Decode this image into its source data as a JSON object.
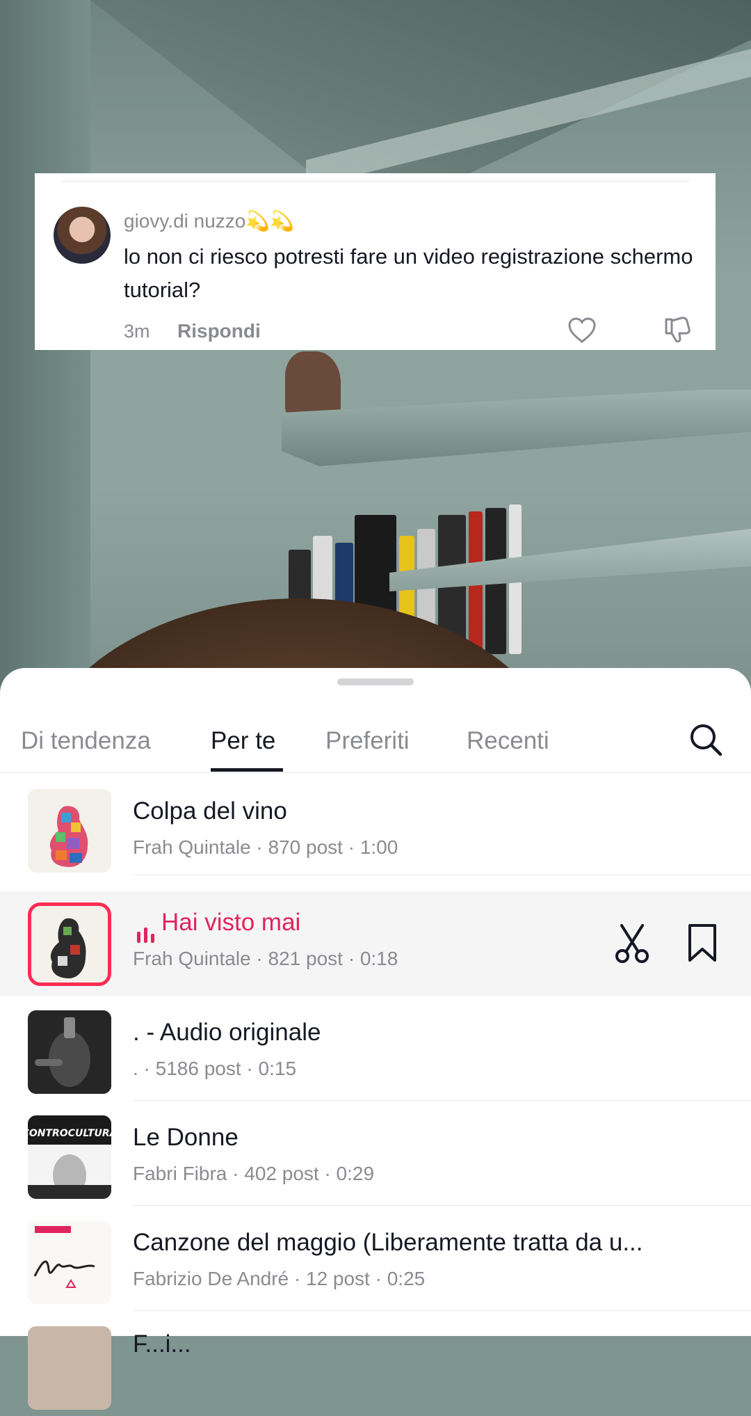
{
  "comment": {
    "username": "giovy.di nuzzo💫💫",
    "text": "lo non ci riesco potresti fare un video registrazione schermo tutorial?",
    "time": "3m",
    "reply_label": "Rispondi"
  },
  "tabs": [
    {
      "label": "Di tendenza",
      "active": false
    },
    {
      "label": "Per te",
      "active": true
    },
    {
      "label": "Preferiti",
      "active": false
    },
    {
      "label": "Recenti",
      "active": false
    }
  ],
  "songs": [
    {
      "title": "Colpa del vino",
      "meta": "Frah Quintale · 870 post · 1:00",
      "playing": false
    },
    {
      "title": "Hai visto mai",
      "meta": "Frah Quintale · 821 post · 0:18",
      "playing": true
    },
    {
      "title": ". - Audio originale",
      "meta": ". · 5186 post · 0:15",
      "playing": false
    },
    {
      "title": "Le Donne",
      "meta": "Fabri Fibra · 402 post · 0:29",
      "playing": false
    },
    {
      "title": "Canzone del maggio (Liberamente tratta da u...",
      "meta": "Fabrizio De André · 12 post · 0:25",
      "playing": false
    },
    {
      "title": "F...i...",
      "meta": "",
      "playing": false
    }
  ],
  "cover_labels": {
    "controcultura": "CONTROCULTURA"
  },
  "colors": {
    "accent": "#fe2c55",
    "playing_title": "#e0245e",
    "text_primary": "#161823",
    "text_secondary": "#8a8b91"
  }
}
